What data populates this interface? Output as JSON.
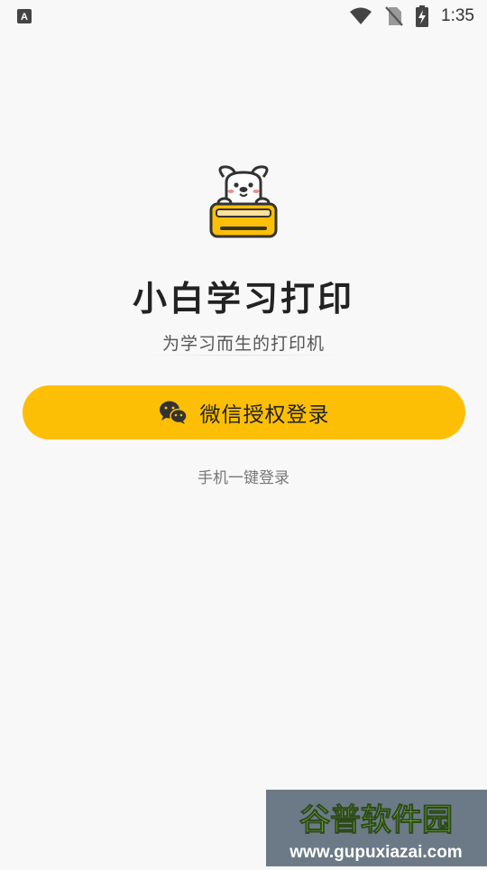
{
  "status_bar": {
    "time": "1:35",
    "icons": [
      "app-notification-icon",
      "wifi-icon",
      "no-sim-icon",
      "battery-charging-icon"
    ]
  },
  "app": {
    "title": "小白学习打印",
    "subtitle": "为学习而生的打印机"
  },
  "actions": {
    "wechat_login_label": "微信授权登录",
    "phone_login_label": "手机一键登录"
  },
  "colors": {
    "accent": "#fdbf05",
    "background": "#f8f8f8",
    "title": "#222222"
  },
  "watermark": {
    "line1": "谷普软件园",
    "line2": "www.gupuxiazai.com"
  }
}
